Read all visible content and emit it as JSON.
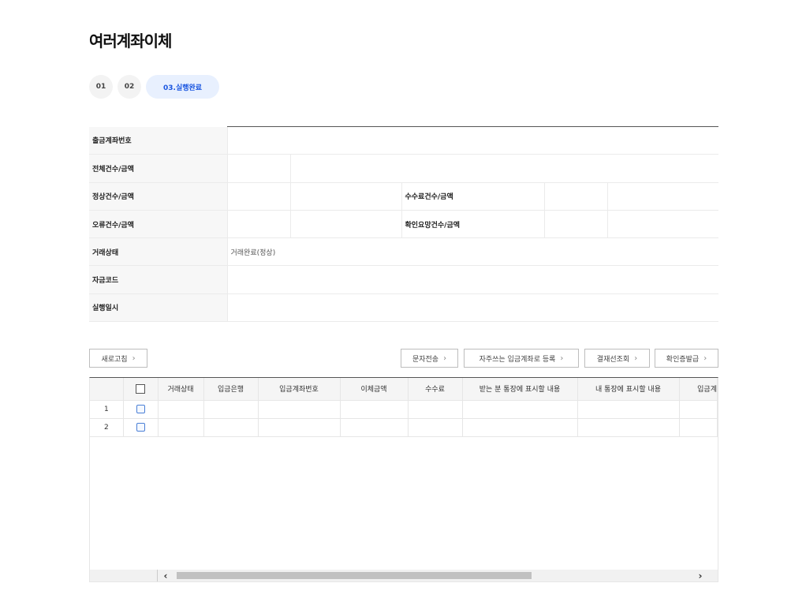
{
  "page": {
    "title": "여러계좌이체"
  },
  "steps": [
    {
      "label": "01"
    },
    {
      "label": "02"
    },
    {
      "label": "03.실행완료"
    }
  ],
  "info": {
    "withdraw_account_label": "출금계좌번호",
    "total_count_amount_label": "전체건수/금액",
    "normal_count_amount_label": "정상건수/금액",
    "fee_count_amount_label": "수수료건수/금액",
    "error_count_amount_label": "오류건수/금액",
    "check_required_count_amount_label": "확인요망건수/금액",
    "transaction_status_label": "거래상태",
    "transaction_status_value": "거래완료(정상)",
    "fund_code_label": "자금코드",
    "executed_at_label": "실행일시"
  },
  "buttons": {
    "refresh": "새로고침",
    "sms": "문자전송",
    "register_frequent": "자주쓰는 입금계좌로 등록",
    "approval_lookup": "결재선조회",
    "confirmation_issue": "확인증발급"
  },
  "grid": {
    "columns": [
      "거래상태",
      "입금은행",
      "입금계좌번호",
      "이체금액",
      "수수료",
      "받는 분 통장에 표시할 내용",
      "내 통장에 표시할 내용",
      "입금계"
    ],
    "rows": [
      {
        "no": "1"
      },
      {
        "no": "2"
      }
    ]
  }
}
